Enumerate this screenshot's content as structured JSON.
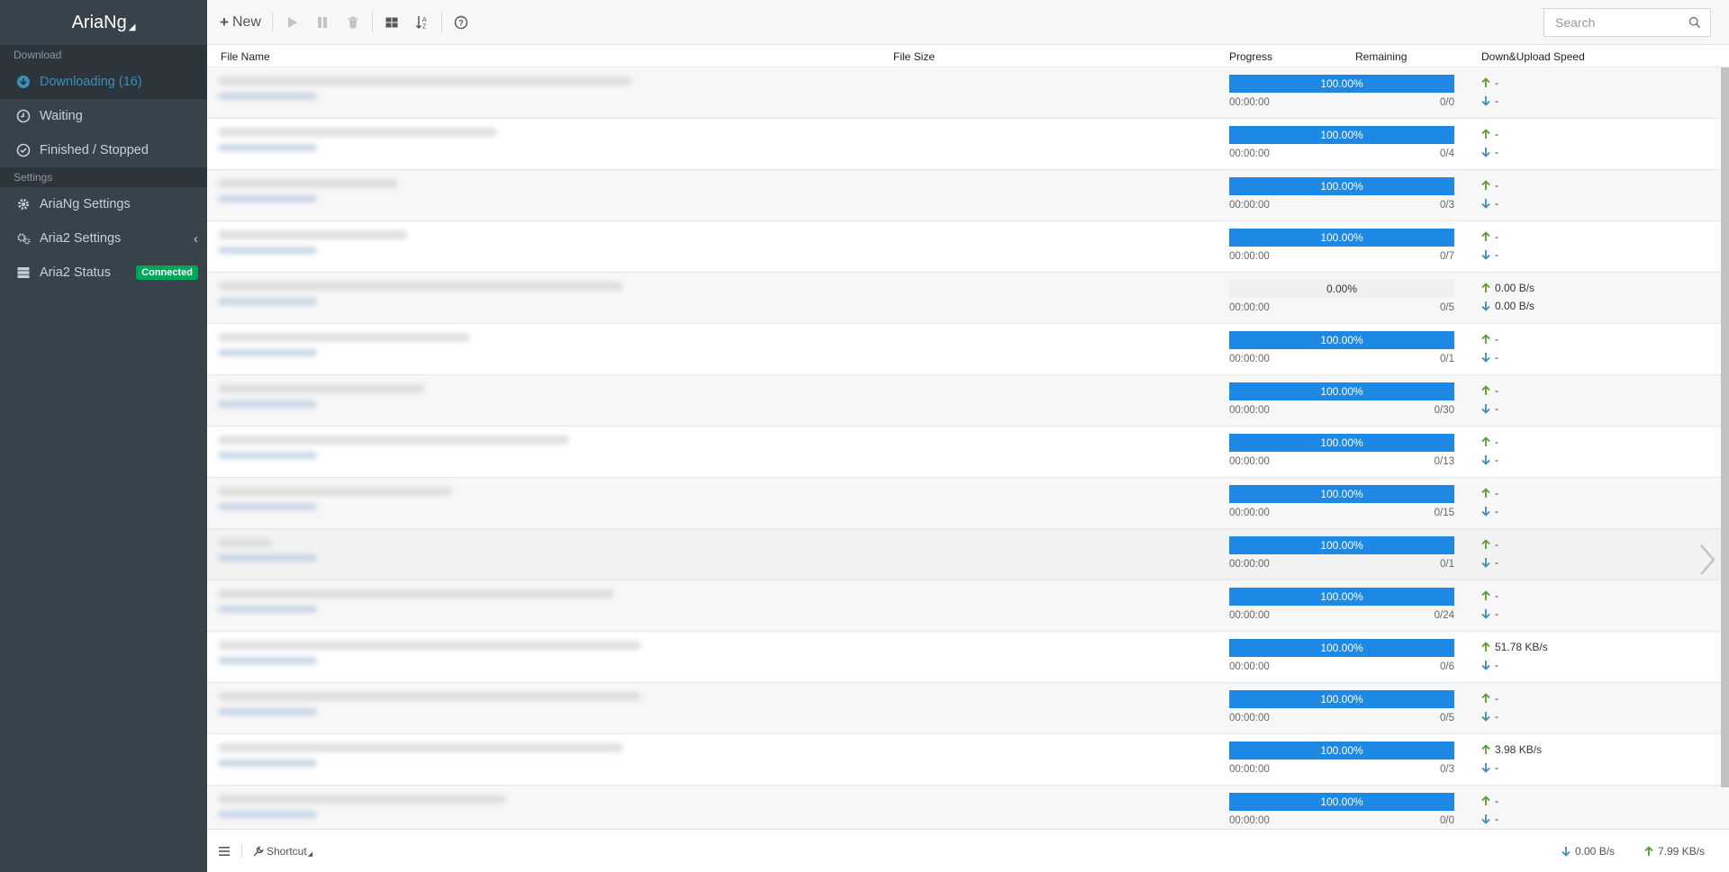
{
  "app": {
    "title": "AriaNg"
  },
  "sidebar": {
    "download_header": "Download",
    "settings_header": "Settings",
    "items": [
      {
        "label": "Downloading (16)",
        "icon": "download-circle-icon"
      },
      {
        "label": "Waiting",
        "icon": "clock-icon"
      },
      {
        "label": "Finished / Stopped",
        "icon": "check-circle-icon"
      }
    ],
    "settings_items": [
      {
        "label": "AriaNg Settings",
        "icon": "gear-icon"
      },
      {
        "label": "Aria2 Settings",
        "icon": "gears-icon"
      },
      {
        "label": "Aria2 Status",
        "icon": "server-icon",
        "badge": "Connected"
      }
    ]
  },
  "toolbar": {
    "new_label": "New",
    "search_placeholder": "Search"
  },
  "table": {
    "headers": {
      "file_name": "File Name",
      "file_size": "File Size",
      "progress": "Progress",
      "remaining": "Remaining",
      "speed": "Down&Upload Speed"
    },
    "rows": [
      {
        "progress": 1.0,
        "progress_text": "100.00%",
        "remaining": "00:00:00",
        "connections": "0/0",
        "up": "-",
        "down": "-"
      },
      {
        "progress": 1.0,
        "progress_text": "100.00%",
        "remaining": "00:00:00",
        "connections": "0/4",
        "up": "-",
        "down": "-"
      },
      {
        "progress": 1.0,
        "progress_text": "100.00%",
        "remaining": "00:00:00",
        "connections": "0/3",
        "up": "-",
        "down": "-"
      },
      {
        "progress": 1.0,
        "progress_text": "100.00%",
        "remaining": "00:00:00",
        "connections": "0/7",
        "up": "-",
        "down": "-"
      },
      {
        "progress": 0.0,
        "progress_text": "0.00%",
        "remaining": "00:00:00",
        "connections": "0/5",
        "up": "0.00 B/s",
        "down": "0.00 B/s"
      },
      {
        "progress": 1.0,
        "progress_text": "100.00%",
        "remaining": "00:00:00",
        "connections": "0/1",
        "up": "-",
        "down": "-"
      },
      {
        "progress": 1.0,
        "progress_text": "100.00%",
        "remaining": "00:00:00",
        "connections": "0/30",
        "up": "-",
        "down": "-"
      },
      {
        "progress": 1.0,
        "progress_text": "100.00%",
        "remaining": "00:00:00",
        "connections": "0/13",
        "up": "-",
        "down": "-"
      },
      {
        "progress": 1.0,
        "progress_text": "100.00%",
        "remaining": "00:00:00",
        "connections": "0/15",
        "up": "-",
        "down": "-"
      },
      {
        "progress": 1.0,
        "progress_text": "100.00%",
        "remaining": "00:00:00",
        "connections": "0/1",
        "up": "-",
        "down": "-"
      },
      {
        "progress": 1.0,
        "progress_text": "100.00%",
        "remaining": "00:00:00",
        "connections": "0/24",
        "up": "-",
        "down": "-"
      },
      {
        "progress": 1.0,
        "progress_text": "100.00%",
        "remaining": "00:00:00",
        "connections": "0/6",
        "up": "51.78 KB/s",
        "down": "-"
      },
      {
        "progress": 1.0,
        "progress_text": "100.00%",
        "remaining": "00:00:00",
        "connections": "0/5",
        "up": "-",
        "down": "-"
      },
      {
        "progress": 1.0,
        "progress_text": "100.00%",
        "remaining": "00:00:00",
        "connections": "0/3",
        "up": "3.98 KB/s",
        "down": "-"
      },
      {
        "progress": 1.0,
        "progress_text": "100.00%",
        "remaining": "00:00:00",
        "connections": "0/0",
        "up": "-",
        "down": "-"
      }
    ]
  },
  "footer": {
    "shortcut_label": "Shortcut",
    "global_down": "0.00 B/s",
    "global_up": "7.99 KB/s"
  },
  "colors": {
    "sidebar_bg": "#37424b",
    "accent": "#3c8dbc",
    "progress_bar": "#1e88e5",
    "up_arrow": "#5a9e2f",
    "down_arrow": "#3c8dbc",
    "badge": "#00a65a"
  }
}
